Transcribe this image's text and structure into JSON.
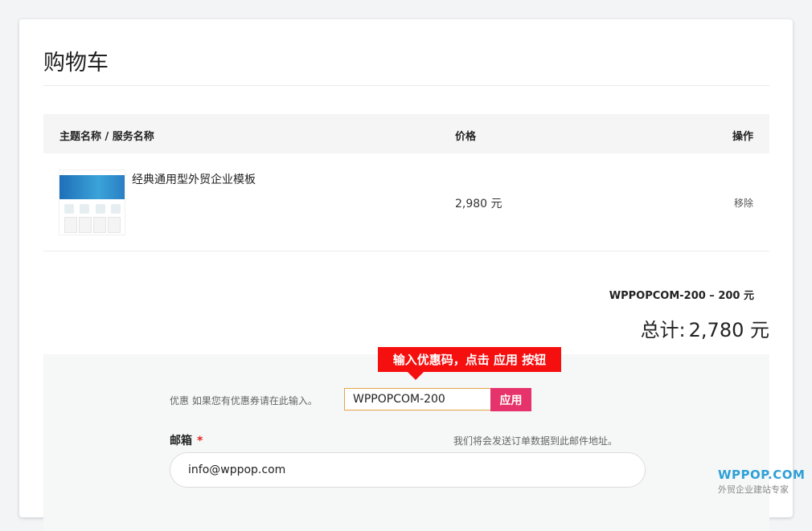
{
  "page_title": "购物车",
  "table": {
    "headers": {
      "name": "主题名称 / 服务名称",
      "price": "价格",
      "action": "操作"
    },
    "rows": [
      {
        "name": "经典通用型外贸企业模板",
        "price": "2,980 元",
        "remove_label": "移除",
        "thumbnail": "template-thumbnail"
      }
    ]
  },
  "summary": {
    "coupon_line": "WPPOPCOM-200 – 200 元",
    "total_label": "总计:",
    "total_value": "2,780 元"
  },
  "coupon": {
    "label": "优惠 如果您有优惠券请在此输入。",
    "value": "WPPOPCOM-200",
    "apply_label": "应用"
  },
  "email": {
    "label": "邮箱",
    "required_mark": "*",
    "hint": "我们将会发送订单数据到此邮件地址。",
    "value": "info@wppop.com"
  },
  "callout_text": "输入优惠码，点击 应用 按钮",
  "watermark": {
    "brand": "WPPOP.COM",
    "tagline": "外贸企业建站专家"
  },
  "colors": {
    "apply_button": "#e6336b",
    "callout": "#f50f0f",
    "coupon_border": "#e5a34a",
    "required": "#e02424",
    "watermark": "#2ea0d6"
  }
}
